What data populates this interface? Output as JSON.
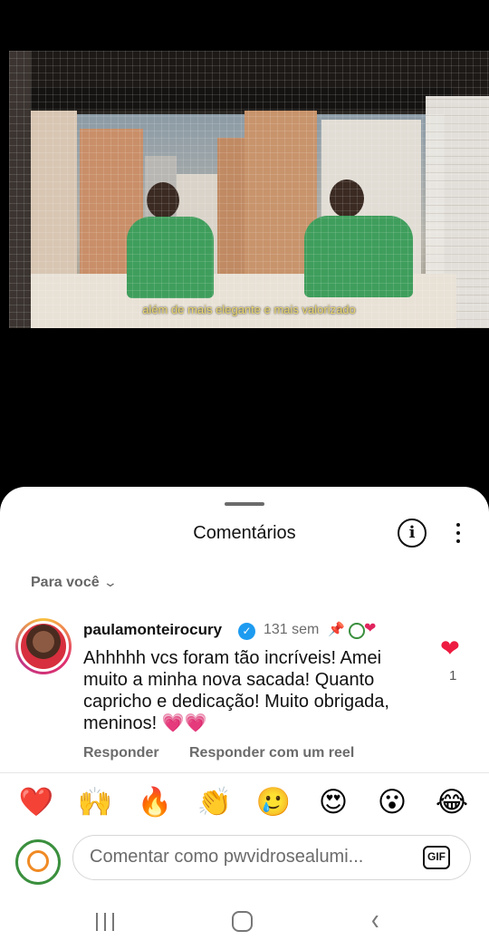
{
  "video": {
    "caption": "além de mais elegante e mais valorizado"
  },
  "sheet": {
    "title": "Comentários",
    "filter_label": "Para você",
    "comment": {
      "username": "paulamonteirocury",
      "time": "131 sem",
      "text": "Ahhhhh vcs foram tão incríveis! Amei muito a minha nova sacada! Quanto capricho e dedicação! Muito obrigada, meninos! 💗💗",
      "like_count": "1",
      "reply_label": "Responder",
      "reply_reel_label": "Responder com um reel"
    },
    "emojis": [
      "❤️",
      "🙌",
      "🔥",
      "👏",
      "🥲",
      "😍",
      "😮",
      "😂"
    ],
    "input_placeholder": "Comentar como pwvidrosealumi...",
    "gif_label": "GIF"
  },
  "icons": {
    "info": "info-icon",
    "more": "more-vertical-icon",
    "verified": "verified-badge-icon",
    "pin": "pin-icon",
    "like": "heart-icon"
  },
  "colors": {
    "like_red": "#ed1c40",
    "verified_blue": "#1d9bf0",
    "secondary_text": "#6b6b6b"
  }
}
